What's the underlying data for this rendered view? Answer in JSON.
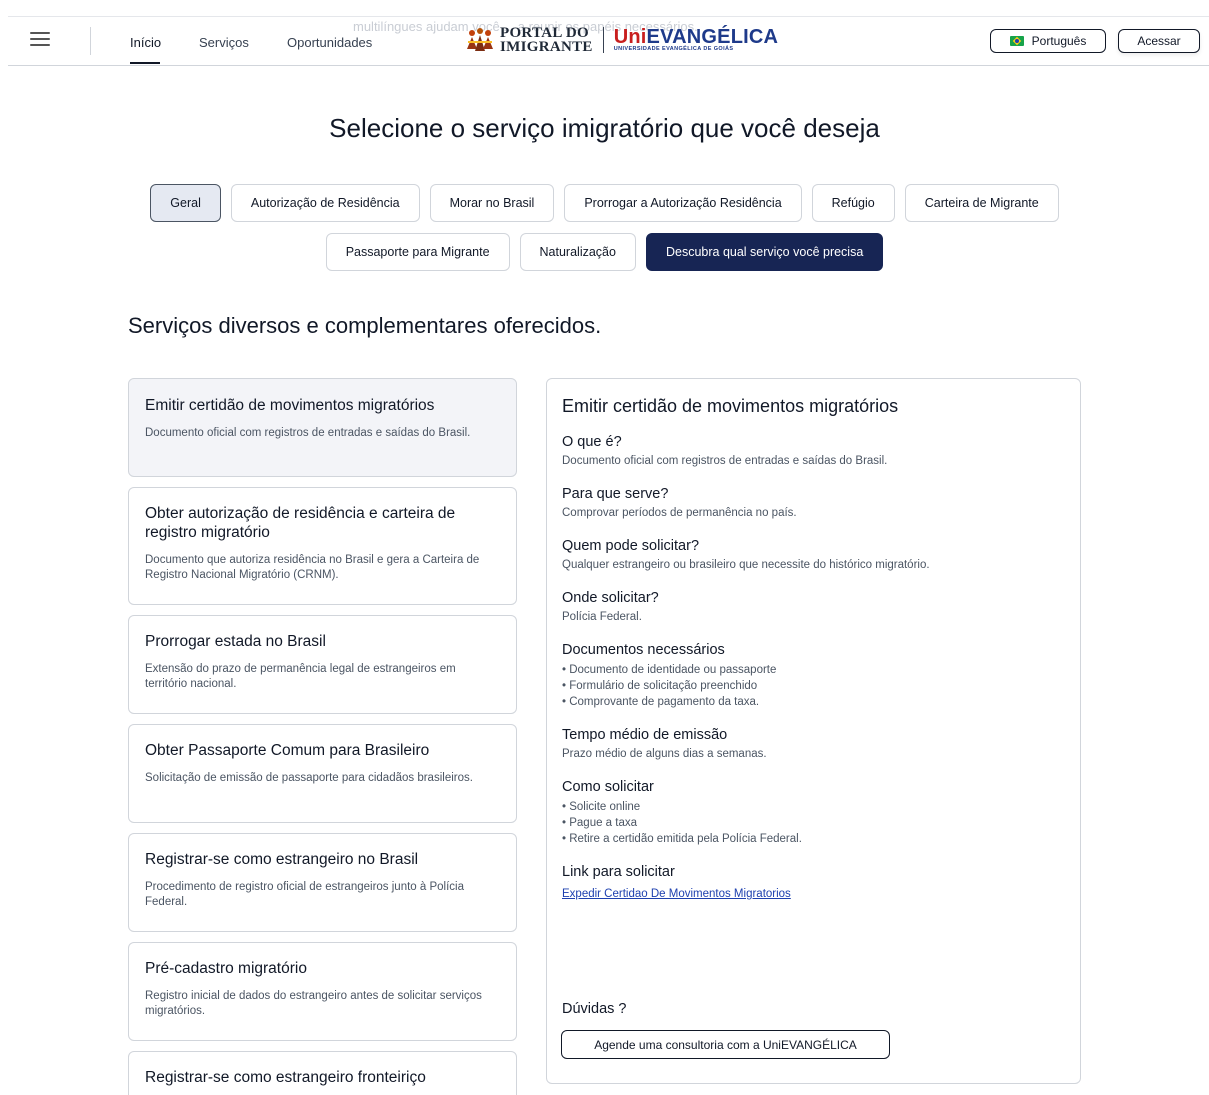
{
  "header": {
    "ghost_text": "multilíngues ajudam você ... a reunir os papéis necessários.",
    "nav": [
      {
        "label": "Início"
      },
      {
        "label": "Serviços"
      },
      {
        "label": "Oportunidades"
      }
    ],
    "logo": {
      "portal_line1": "PORTAL DO",
      "portal_line2": "IMIGRANTE",
      "uni_red": "Uni",
      "uni_blue": "EVANGÉLICA",
      "uni_small": "UNIVERSIDADE EVANGÉLICA DE GOIÁS"
    },
    "language_label": "Português",
    "login_label": "Acessar"
  },
  "page_title": "Selecione o serviço imigratório que você deseja",
  "tabs_row1": [
    "Geral",
    "Autorização de Residência",
    "Morar no Brasil",
    "Prorrogar a Autorização Residência",
    "Refúgio",
    "Carteira de Migrante"
  ],
  "tabs_row2": [
    "Passaporte para Migrante",
    "Naturalização",
    "Descubra qual serviço você precisa"
  ],
  "section_title": "Serviços diversos e complementares oferecidos.",
  "services": [
    {
      "title": "Emitir certidão de movimentos migratórios",
      "desc": "Documento oficial com registros de entradas e saídas do Brasil."
    },
    {
      "title": "Obter autorização de residência e carteira de registro migratório",
      "desc": "Documento que autoriza residência no Brasil e gera a Carteira de Registro Nacional Migratório (CRNM)."
    },
    {
      "title": "Prorrogar estada no Brasil",
      "desc": "Extensão do prazo de permanência legal de estrangeiros em território nacional."
    },
    {
      "title": "Obter Passaporte Comum para Brasileiro",
      "desc": "Solicitação de emissão de passaporte para cidadãos brasileiros."
    },
    {
      "title": "Registrar-se como estrangeiro no Brasil",
      "desc": "Procedimento de registro oficial de estrangeiros junto à Polícia Federal."
    },
    {
      "title": "Pré-cadastro migratório",
      "desc": "Registro inicial de dados do estrangeiro antes de solicitar serviços migratórios."
    },
    {
      "title": "Registrar-se como estrangeiro fronteiriço",
      "desc": ""
    }
  ],
  "detail": {
    "title": "Emitir certidão de movimentos migratórios",
    "what_h": "O que é?",
    "what_p": "Documento oficial com registros de entradas e saídas do Brasil.",
    "purpose_h": "Para que serve?",
    "purpose_p": "Comprovar períodos de permanência no país.",
    "who_h": "Quem pode solicitar?",
    "who_p": "Qualquer estrangeiro ou brasileiro que necessite do histórico migratório.",
    "where_h": "Onde solicitar?",
    "where_p": "Polícia Federal.",
    "docs_h": "Documentos necessários",
    "docs": [
      "Documento de identidade ou passaporte",
      "Formulário de solicitação preenchido",
      "Comprovante de pagamento da taxa."
    ],
    "time_h": "Tempo médio de emissão",
    "time_p": "Prazo médio de alguns dias a semanas.",
    "how_h": "Como solicitar",
    "how": [
      "Solicite online",
      "Pague a taxa",
      "Retire a certidão emitida pela Polícia Federal."
    ],
    "link_h": "Link para solicitar",
    "link_text": "Expedir Certidao De Movimentos Migratorios",
    "doubts_h": "Dúvidas ?",
    "consult_label": "Agende uma consultoria com a UniEVANGÉLICA"
  }
}
